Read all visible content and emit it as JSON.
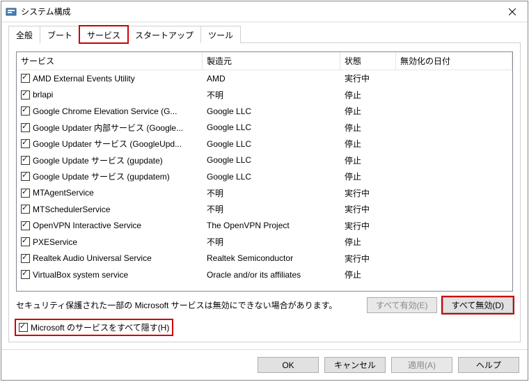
{
  "window": {
    "title": "システム構成"
  },
  "tabs": {
    "general": "全般",
    "boot": "ブート",
    "services": "サービス",
    "startup": "スタートアップ",
    "tools": "ツール"
  },
  "columns": {
    "service": "サービス",
    "manufacturer": "製造元",
    "state": "状態",
    "disable_date": "無効化の日付"
  },
  "rows": [
    {
      "name": "AMD External Events Utility",
      "mfr": "AMD",
      "state": "実行中"
    },
    {
      "name": "brlapi",
      "mfr": "不明",
      "state": "停止"
    },
    {
      "name": "Google Chrome Elevation Service (G...",
      "mfr": "Google LLC",
      "state": "停止"
    },
    {
      "name": "Google Updater 内部サービス (Google...",
      "mfr": "Google LLC",
      "state": "停止"
    },
    {
      "name": "Google Updater サービス (GoogleUpd...",
      "mfr": "Google LLC",
      "state": "停止"
    },
    {
      "name": "Google Update サービス (gupdate)",
      "mfr": "Google LLC",
      "state": "停止"
    },
    {
      "name": "Google Update サービス (gupdatem)",
      "mfr": "Google LLC",
      "state": "停止"
    },
    {
      "name": "MTAgentService",
      "mfr": "不明",
      "state": "実行中"
    },
    {
      "name": "MTSchedulerService",
      "mfr": "不明",
      "state": "実行中"
    },
    {
      "name": "OpenVPN Interactive Service",
      "mfr": "The OpenVPN Project",
      "state": "実行中"
    },
    {
      "name": "PXEService",
      "mfr": "不明",
      "state": "停止"
    },
    {
      "name": "Realtek Audio Universal Service",
      "mfr": "Realtek Semiconductor",
      "state": "実行中"
    },
    {
      "name": "VirtualBox system service",
      "mfr": "Oracle and/or its affiliates",
      "state": "停止"
    }
  ],
  "note": "セキュリティ保護された一部の Microsoft サービスは無効にできない場合があります。",
  "buttons": {
    "enable_all": "すべて有効(E)",
    "disable_all": "すべて無効(D)",
    "hide_ms": "Microsoft のサービスをすべて隠す(H)",
    "ok": "OK",
    "cancel": "キャンセル",
    "apply": "適用(A)",
    "help": "ヘルプ"
  }
}
